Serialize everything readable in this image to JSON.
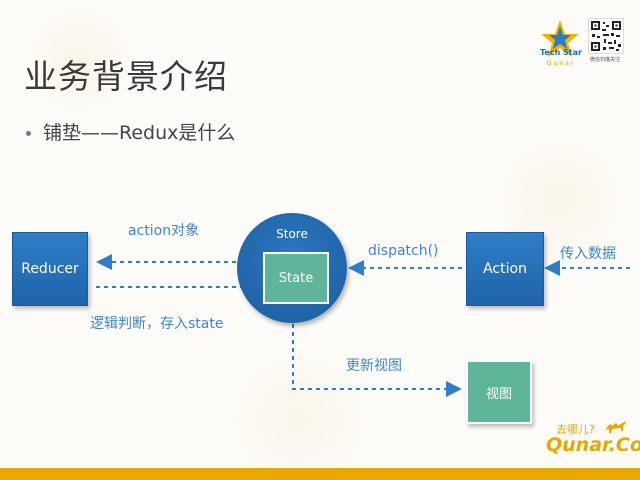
{
  "slide": {
    "title": "业务背景介绍",
    "bullet": "铺垫——Redux是什么"
  },
  "logo": {
    "brand_line1": "Tech Star",
    "brand_line2": "Qunar",
    "qr_caption": "微信扫描关注"
  },
  "diagram": {
    "reducer_label": "Reducer",
    "store_label": "Store",
    "state_label": "State",
    "action_label": "Action",
    "view_label": "视图",
    "edge_action_object": "action对象",
    "edge_logic": "逻辑判断，存入state",
    "edge_dispatch": "dispatch()",
    "edge_input": "传入数据",
    "edge_update_view": "更新视图"
  },
  "footer": {
    "qunar_top": "去哪儿?",
    "qunar_main": "Qunar.Com"
  },
  "colors": {
    "blue_box": "#1e64a8",
    "green_box": "#5fb59a",
    "label_blue": "#3c86cf",
    "accent_yellow": "#e7a800"
  }
}
